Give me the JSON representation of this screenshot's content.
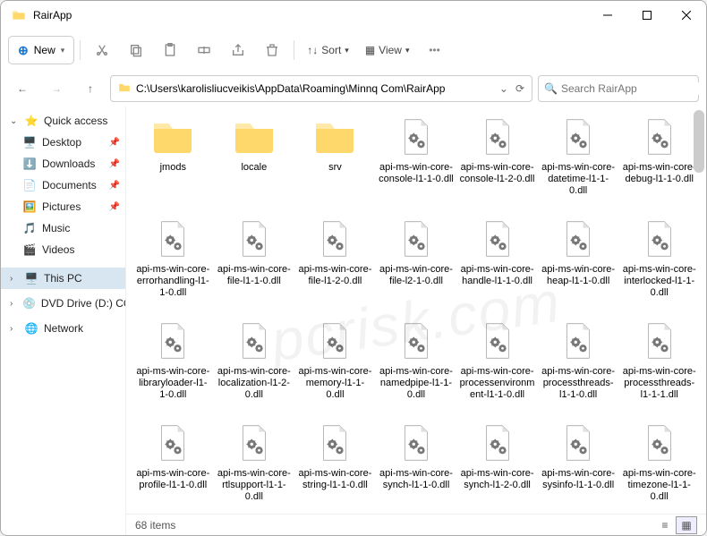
{
  "window": {
    "title": "RairApp"
  },
  "toolbar": {
    "new": "New",
    "sort": "Sort",
    "view": "View"
  },
  "address": {
    "path": "C:\\Users\\karolisliucveikis\\AppData\\Roaming\\Minnq Com\\RairApp"
  },
  "search": {
    "placeholder": "Search RairApp"
  },
  "nav": {
    "quick": "Quick access",
    "desktop": "Desktop",
    "downloads": "Downloads",
    "documents": "Documents",
    "pictures": "Pictures",
    "music": "Music",
    "videos": "Videos",
    "thispc": "This PC",
    "dvd": "DVD Drive (D:) CCCC",
    "network": "Network"
  },
  "status": {
    "count": "68 items"
  },
  "items": [
    {
      "type": "folder",
      "label": "jmods"
    },
    {
      "type": "folder",
      "label": "locale"
    },
    {
      "type": "folder",
      "label": "srv"
    },
    {
      "type": "dll",
      "label": "api-ms-win-core-console-l1-1-0.dll"
    },
    {
      "type": "dll",
      "label": "api-ms-win-core-console-l1-2-0.dll"
    },
    {
      "type": "dll",
      "label": "api-ms-win-core-datetime-l1-1-0.dll"
    },
    {
      "type": "dll",
      "label": "api-ms-win-core-debug-l1-1-0.dll"
    },
    {
      "type": "dll",
      "label": "api-ms-win-core-errorhandling-l1-1-0.dll"
    },
    {
      "type": "dll",
      "label": "api-ms-win-core-file-l1-1-0.dll"
    },
    {
      "type": "dll",
      "label": "api-ms-win-core-file-l1-2-0.dll"
    },
    {
      "type": "dll",
      "label": "api-ms-win-core-file-l2-1-0.dll"
    },
    {
      "type": "dll",
      "label": "api-ms-win-core-handle-l1-1-0.dll"
    },
    {
      "type": "dll",
      "label": "api-ms-win-core-heap-l1-1-0.dll"
    },
    {
      "type": "dll",
      "label": "api-ms-win-core-interlocked-l1-1-0.dll"
    },
    {
      "type": "dll",
      "label": "api-ms-win-core-libraryloader-l1-1-0.dll"
    },
    {
      "type": "dll",
      "label": "api-ms-win-core-localization-l1-2-0.dll"
    },
    {
      "type": "dll",
      "label": "api-ms-win-core-memory-l1-1-0.dll"
    },
    {
      "type": "dll",
      "label": "api-ms-win-core-namedpipe-l1-1-0.dll"
    },
    {
      "type": "dll",
      "label": "api-ms-win-core-processenvironment-l1-1-0.dll"
    },
    {
      "type": "dll",
      "label": "api-ms-win-core-processthreads-l1-1-0.dll"
    },
    {
      "type": "dll",
      "label": "api-ms-win-core-processthreads-l1-1-1.dll"
    },
    {
      "type": "dll",
      "label": "api-ms-win-core-profile-l1-1-0.dll"
    },
    {
      "type": "dll",
      "label": "api-ms-win-core-rtlsupport-l1-1-0.dll"
    },
    {
      "type": "dll",
      "label": "api-ms-win-core-string-l1-1-0.dll"
    },
    {
      "type": "dll",
      "label": "api-ms-win-core-synch-l1-1-0.dll"
    },
    {
      "type": "dll",
      "label": "api-ms-win-core-synch-l1-2-0.dll"
    },
    {
      "type": "dll",
      "label": "api-ms-win-core-sysinfo-l1-1-0.dll"
    },
    {
      "type": "dll",
      "label": "api-ms-win-core-timezone-l1-1-0.dll"
    }
  ]
}
